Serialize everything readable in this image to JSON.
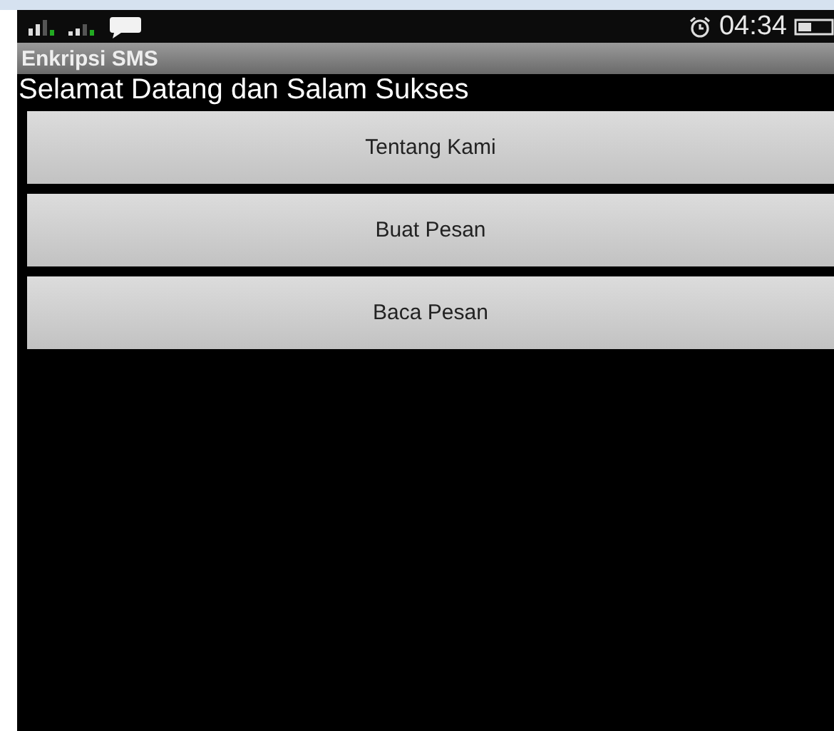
{
  "status_bar": {
    "time": "04:34"
  },
  "app_bar": {
    "title": "Enkripsi SMS"
  },
  "greeting": "Selamat Datang dan Salam Sukses",
  "buttons": [
    {
      "label": "Tentang Kami"
    },
    {
      "label": "Buat Pesan"
    },
    {
      "label": "Baca Pesan"
    }
  ]
}
